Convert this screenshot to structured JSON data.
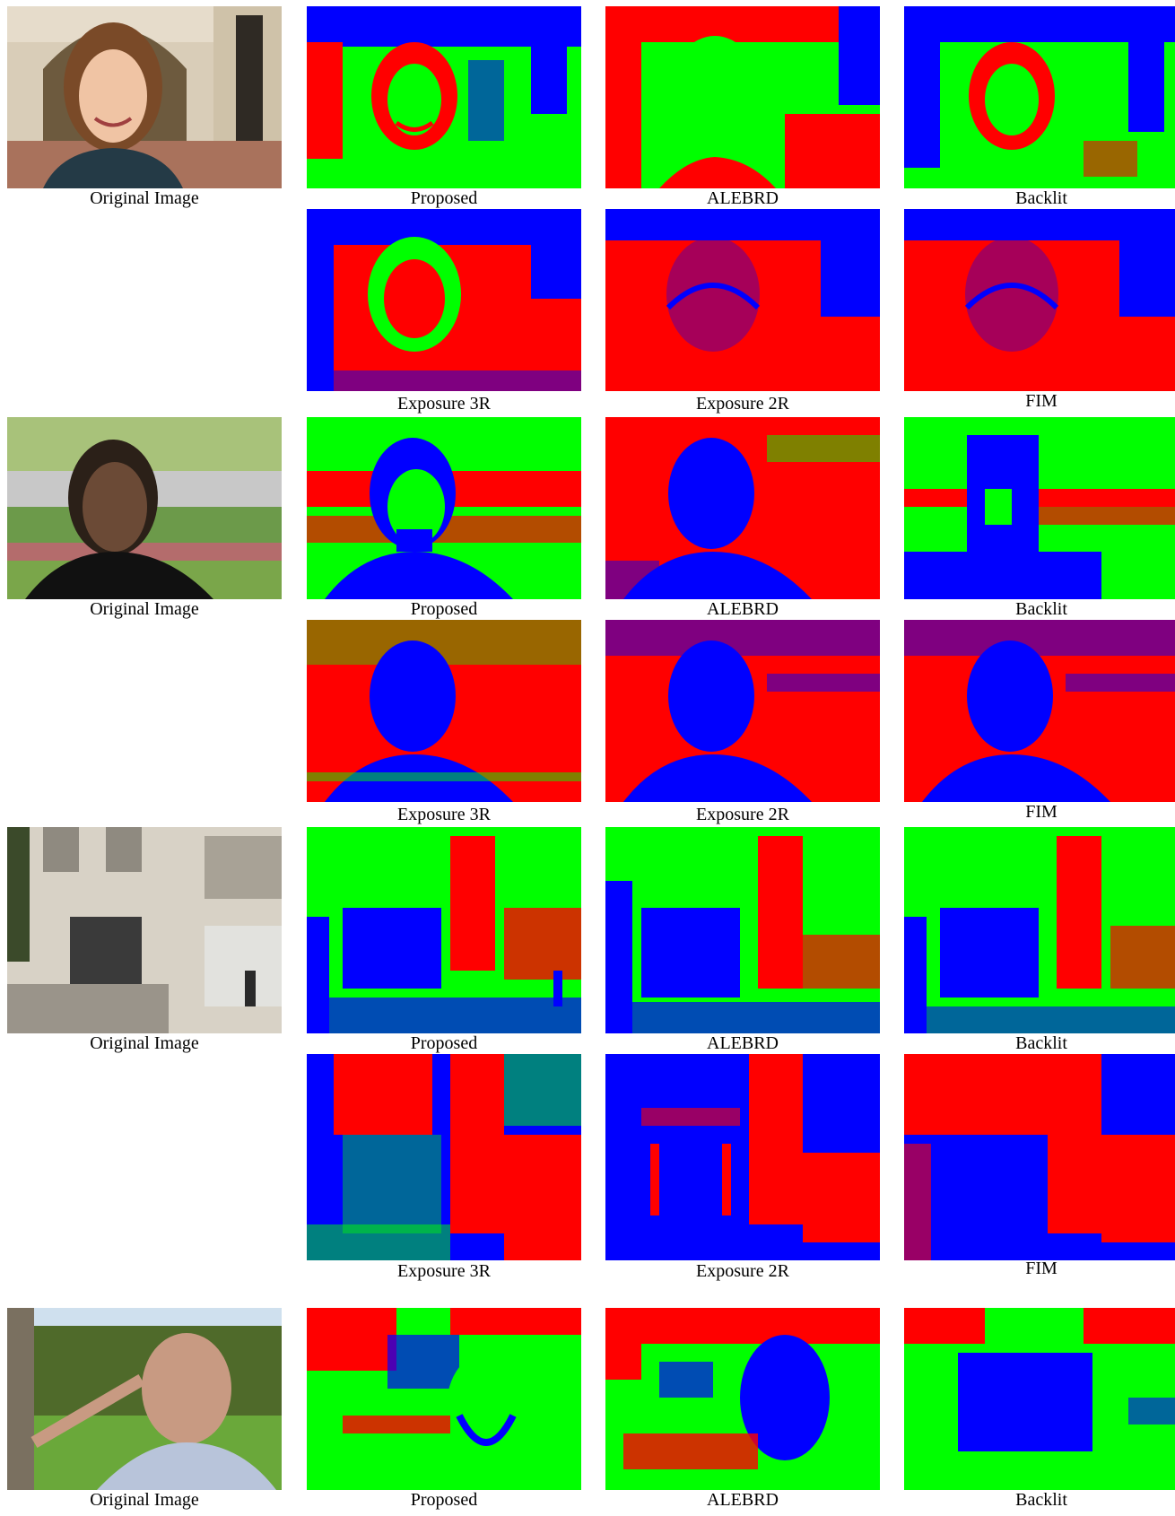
{
  "palette": {
    "red": "#ff0000",
    "green": "#00ff00",
    "blue": "#0000ff"
  },
  "groups": [
    {
      "original": {
        "caption": "Original Image",
        "scene": "woman-arcade-photo"
      },
      "top_row": [
        {
          "caption": "Proposed"
        },
        {
          "caption": "ALEBRD"
        },
        {
          "caption": "Backlit"
        }
      ],
      "bottom_row": [
        {
          "caption": "Exposure 3R"
        },
        {
          "caption": "Exposure 2R"
        },
        {
          "caption": "FIM"
        }
      ]
    },
    {
      "original": {
        "caption": "Original Image",
        "scene": "man-parking-lot-photo"
      },
      "top_row": [
        {
          "caption": "Proposed"
        },
        {
          "caption": "ALEBRD"
        },
        {
          "caption": "Backlit"
        }
      ],
      "bottom_row": [
        {
          "caption": "Exposure 3R"
        },
        {
          "caption": "Exposure 2R"
        },
        {
          "caption": "FIM"
        }
      ]
    },
    {
      "original": {
        "caption": "Original Image",
        "scene": "building-entrance-photo"
      },
      "top_row": [
        {
          "caption": "Proposed"
        },
        {
          "caption": "ALEBRD"
        },
        {
          "caption": "Backlit"
        }
      ],
      "bottom_row": [
        {
          "caption": "Exposure 3R"
        },
        {
          "caption": "Exposure 2R"
        },
        {
          "caption": "FIM"
        }
      ]
    },
    {
      "original": {
        "caption": "Original Image",
        "scene": "man-pointing-photo"
      },
      "top_row": [
        {
          "caption": "Proposed"
        },
        {
          "caption": "ALEBRD"
        },
        {
          "caption": "Backlit"
        }
      ]
    }
  ]
}
